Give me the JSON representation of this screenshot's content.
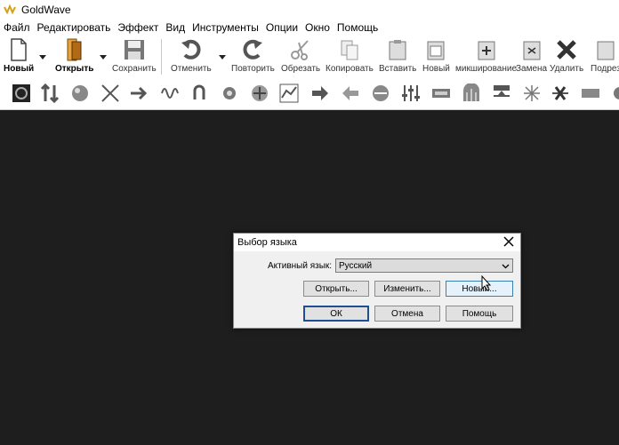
{
  "window": {
    "title": "GoldWave"
  },
  "menu": [
    "Файл",
    "Редактировать",
    "Эффект",
    "Вид",
    "Инструменты",
    "Опции",
    "Окно",
    "Помощь"
  ],
  "toolbar": {
    "new": "Новый",
    "open": "Открыть",
    "save": "Сохранить",
    "undo": "Отменить",
    "redo": "Повторить",
    "trim": "Обрезать",
    "copy": "Копировать",
    "paste": "Вставить",
    "pastenew": "Новый",
    "mix": "микширование",
    "replace": "Замена",
    "delete": "Удалить",
    "more": "Подрез"
  },
  "dialog": {
    "title": "Выбор языка",
    "active_label": "Активный язык:",
    "selected_language": "Русский",
    "open_button": "Открыть...",
    "change_button": "Изменить...",
    "new_button": "Новый...",
    "ok_button": "ОК",
    "cancel_button": "Отмена",
    "help_button": "Помощь"
  }
}
